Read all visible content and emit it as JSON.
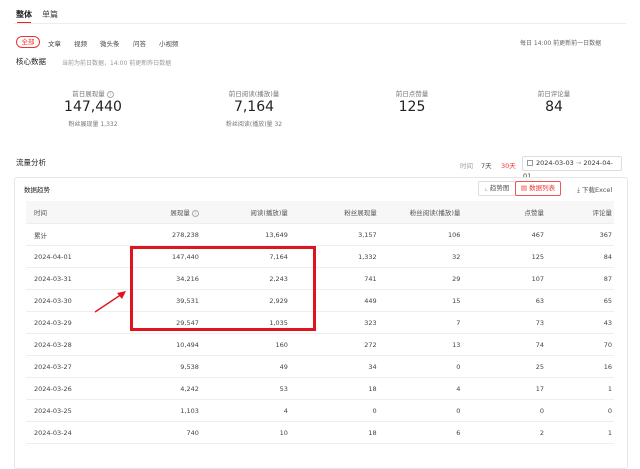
{
  "top_tabs": [
    "整体",
    "单篇"
  ],
  "content_tabs": [
    "全部",
    "文章",
    "视频",
    "微头条",
    "问答",
    "小视频"
  ],
  "update_note": "每日 14:00 前更新前一日数据",
  "core": {
    "title": "核心数据",
    "note": "当前为前日数据，14:00 前更新昨日数据",
    "stats": [
      {
        "label": "前日展现量",
        "value": "147,440",
        "sub": "粉丝展现量 1,332"
      },
      {
        "label": "前日阅读(播放)量",
        "value": "7,164",
        "sub": "粉丝阅读(播放)量 32"
      },
      {
        "label": "前日点赞量",
        "value": "125",
        "sub": ""
      },
      {
        "label": "前日评论量",
        "value": "84",
        "sub": ""
      }
    ]
  },
  "traffic": {
    "title": "流量分析",
    "time_label": "时间",
    "range_7": "7天",
    "range_30": "30天",
    "date_start": "2024-03-03",
    "date_sep": "→",
    "date_end": "2024-04-01"
  },
  "panel": {
    "title": "数据趋势",
    "btn_chart": "趋势图",
    "btn_list": "数据列表",
    "btn_download": "下载Excel"
  },
  "table": {
    "headers": [
      "时间",
      "展现量",
      "阅读(播放)量",
      "粉丝展现量",
      "粉丝阅读(播放)量",
      "点赞量",
      "评论量"
    ],
    "rows": [
      [
        "累计",
        "278,238",
        "13,649",
        "3,157",
        "106",
        "467",
        "367"
      ],
      [
        "2024-04-01",
        "147,440",
        "7,164",
        "1,332",
        "32",
        "125",
        "84"
      ],
      [
        "2024-03-31",
        "34,216",
        "2,243",
        "741",
        "29",
        "107",
        "87"
      ],
      [
        "2024-03-30",
        "39,531",
        "2,929",
        "449",
        "15",
        "63",
        "65"
      ],
      [
        "2024-03-29",
        "29,547",
        "1,035",
        "323",
        "7",
        "73",
        "43"
      ],
      [
        "2024-03-28",
        "10,494",
        "160",
        "272",
        "13",
        "74",
        "70"
      ],
      [
        "2024-03-27",
        "9,538",
        "49",
        "34",
        "0",
        "25",
        "16"
      ],
      [
        "2024-03-26",
        "4,242",
        "53",
        "18",
        "4",
        "17",
        "1"
      ],
      [
        "2024-03-25",
        "1,103",
        "4",
        "0",
        "0",
        "0",
        "0"
      ],
      [
        "2024-03-24",
        "740",
        "10",
        "18",
        "6",
        "2",
        "1"
      ]
    ]
  },
  "colors": {
    "accent": "#e22222",
    "annotation": "#e0141e"
  }
}
